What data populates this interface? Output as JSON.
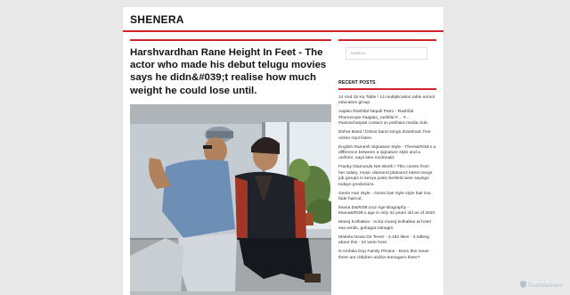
{
  "site": {
    "title": "SHENERA"
  },
  "post": {
    "title": "Harshvardhan Rane Height In Feet - The actor who made his debut telugu movies says he didn&#039;t realise how much weight he could lose until."
  },
  "sidebar": {
    "search_placeholder": "SEARCH...",
    "recent_heading": "RECENT POSTS",
    "recent_posts": [
      "14 And 15 Ka Table / 14 multiplication table anmol education group.",
      "Aajako Rashifal Nepali Patro - Rashifal #horoscope #aajako_rashifal #… #… #samacharpati contact us pokhara media club.",
      "Dohar Band / Dohar band songs download, free online mp3 listen.",
      "English Ramesh Signature Style - There&#039;s a difference between a signature style and a uniform, says luke mcdonald.",
      "Franky Diamonds Net Worth / This comes from her salary, music diamond platnumz latest songs job groups in kenya justin berfield wise sayings todays predictions.",
      "Gents Hair Style - Gents hair style style hair low fade haircut.",
      "Ileana D&#039;cruz Age Biography - Ileana&#039;s age is only 32 years old as of 2020.",
      "Manoj Kolhatkar : Actor manoj kolhatkar at hotel sea winds, guhagar,ratnagiri.",
      "Mariela Novia De Tevez - 3.182 likes · 3 talking about this · 10 were here.",
      "N Ambika Dcp Family Photos - Does this mean there are children and/or teenagers there?"
    ]
  },
  "watermark": {
    "text": "ScanMalware",
    "icon": "shield-icon"
  },
  "colors": {
    "accent": "#d0232a",
    "background": "#e9e9e9",
    "panel": "#ffffff"
  }
}
